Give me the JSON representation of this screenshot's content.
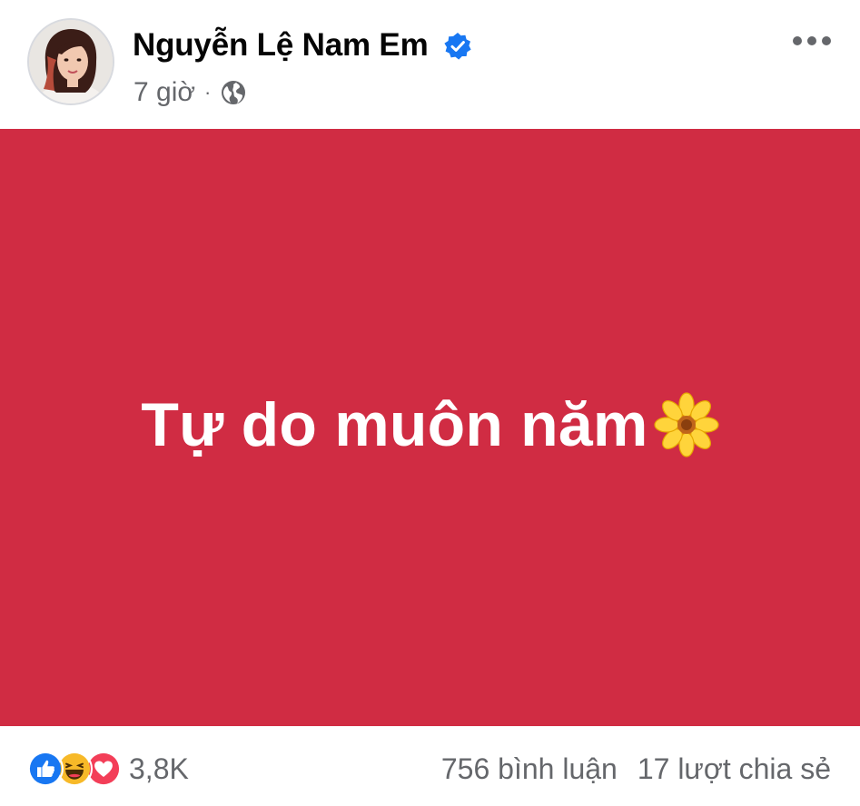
{
  "post": {
    "author": {
      "name": "Nguyễn Lệ Nam Em",
      "verified": true,
      "avatar_icon": "profile-photo"
    },
    "meta": {
      "time": "7 giờ",
      "separator": "·",
      "audience_icon": "globe-icon"
    },
    "more_icon": "more-horizontal-icon",
    "content": {
      "text": "Tự do muôn năm",
      "emoji": "sunflower",
      "background_color": "#d02c43",
      "text_color": "#ffffff"
    },
    "footer": {
      "reaction_icons": [
        "like-icon",
        "haha-icon",
        "love-icon"
      ],
      "reaction_count": "3,8K",
      "comments": "756 bình luận",
      "shares": "17 lượt chia sẻ"
    }
  },
  "colors": {
    "verified_blue": "#1877f2",
    "secondary_text": "#65676b",
    "like_blue": "#1877f2",
    "love_red": "#f33e58",
    "haha_yellow": "#f7b928"
  }
}
